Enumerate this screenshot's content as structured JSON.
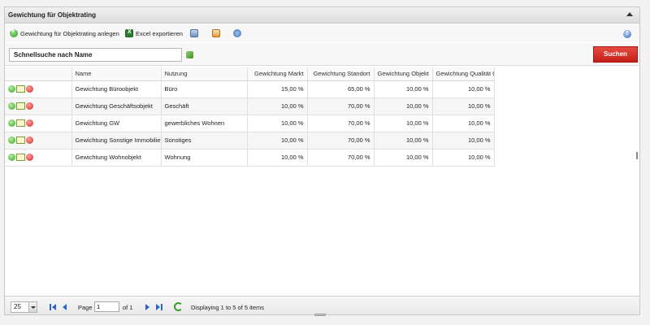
{
  "panel": {
    "title": "Gewichtung für Objektrating"
  },
  "toolbar": {
    "add_label": "Gewichtung für Objektrating anlegen",
    "export_label": "Excel exportieren"
  },
  "search": {
    "placeholder": "Schnellsuche nach Name",
    "button_label": "Suchen"
  },
  "table": {
    "columns": [
      "",
      "Name",
      "Nutzung",
      "Gewichtung Markt",
      "Gewichtung Standort",
      "Gewichtung Objekt",
      "Gewichtung Qualität O"
    ],
    "rows": [
      {
        "name": "Gewichtung Büroobjekt",
        "nutzung": "Büro",
        "markt": "15,00 %",
        "standort": "65,00 %",
        "objekt": "10,00 %",
        "qualitaet": "10,00 %"
      },
      {
        "name": "Gewichtung Geschäftsobjekt",
        "nutzung": "Geschäft",
        "markt": "10,00 %",
        "standort": "70,00 %",
        "objekt": "10,00 %",
        "qualitaet": "10,00 %"
      },
      {
        "name": "Gewichtung GW",
        "nutzung": "gewerbliches Wohnen",
        "markt": "10,00 %",
        "standort": "70,00 %",
        "objekt": "10,00 %",
        "qualitaet": "10,00 %"
      },
      {
        "name": "Gewichtung Sonstige Immobilien",
        "nutzung": "Sonstiges",
        "markt": "10,00 %",
        "standort": "70,00 %",
        "objekt": "10,00 %",
        "qualitaet": "10,00 %"
      },
      {
        "name": "Gewichtung Wohnobjekt",
        "nutzung": "Wohnung",
        "markt": "10,00 %",
        "standort": "70,00 %",
        "objekt": "10,00 %",
        "qualitaet": "10,00 %"
      }
    ]
  },
  "pager": {
    "page_size": "25",
    "page_label": "Page",
    "page_value": "1",
    "of_label": "of 1",
    "status": "Displaying 1 to 5 of 5 items"
  },
  "colors": {
    "search_button": "#d32a25",
    "header_bg": "#e6e6e6",
    "nav_blue": "#2b66c8"
  }
}
